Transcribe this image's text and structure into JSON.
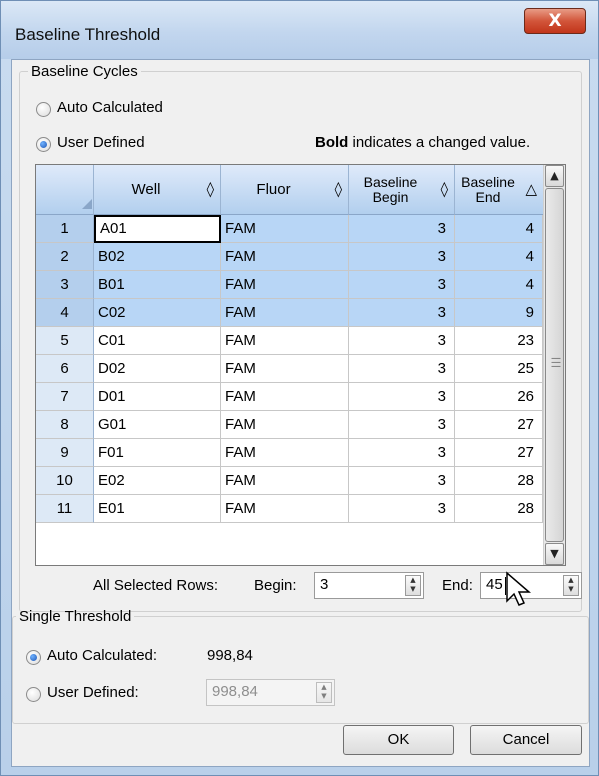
{
  "window": {
    "title": "Baseline Threshold",
    "close_glyph": "X"
  },
  "baseline_cycles": {
    "legend": "Baseline Cycles",
    "auto_label": "Auto Calculated",
    "user_label": "User Defined",
    "selected": "User Defined",
    "note_bold": "Bold",
    "note_rest": " indicates a changed value."
  },
  "grid": {
    "columns": [
      {
        "label": "Well",
        "sort": "◊"
      },
      {
        "label": "Fluor",
        "sort": "◊"
      },
      {
        "label": "Baseline Begin",
        "sort": "◊"
      },
      {
        "label": "Baseline End",
        "sort": "△"
      }
    ],
    "rows": [
      {
        "n": "1",
        "well": "A01",
        "fluor": "FAM",
        "begin": "3",
        "end": "4",
        "selected": true
      },
      {
        "n": "2",
        "well": "B02",
        "fluor": "FAM",
        "begin": "3",
        "end": "4",
        "selected": true
      },
      {
        "n": "3",
        "well": "B01",
        "fluor": "FAM",
        "begin": "3",
        "end": "4",
        "selected": true
      },
      {
        "n": "4",
        "well": "C02",
        "fluor": "FAM",
        "begin": "3",
        "end": "9",
        "selected": true
      },
      {
        "n": "5",
        "well": "C01",
        "fluor": "FAM",
        "begin": "3",
        "end": "23",
        "selected": false
      },
      {
        "n": "6",
        "well": "D02",
        "fluor": "FAM",
        "begin": "3",
        "end": "25",
        "selected": false
      },
      {
        "n": "7",
        "well": "D01",
        "fluor": "FAM",
        "begin": "3",
        "end": "26",
        "selected": false
      },
      {
        "n": "8",
        "well": "G01",
        "fluor": "FAM",
        "begin": "3",
        "end": "27",
        "selected": false
      },
      {
        "n": "9",
        "well": "F01",
        "fluor": "FAM",
        "begin": "3",
        "end": "27",
        "selected": false
      },
      {
        "n": "10",
        "well": "E02",
        "fluor": "FAM",
        "begin": "3",
        "end": "28",
        "selected": false
      },
      {
        "n": "11",
        "well": "E01",
        "fluor": "FAM",
        "begin": "3",
        "end": "28",
        "selected": false
      }
    ]
  },
  "all_selected": {
    "label": "All Selected Rows:",
    "begin_label": "Begin:",
    "begin_value": "3",
    "end_label": "End:",
    "end_value": "45"
  },
  "single_threshold": {
    "legend": "Single Threshold",
    "auto_label": "Auto Calculated:",
    "auto_value": "998,84",
    "user_label": "User Defined:",
    "user_value": "998,84",
    "selected": "Auto Calculated"
  },
  "buttons": {
    "ok": "OK",
    "cancel": "Cancel"
  },
  "colors": {
    "selected_row": "#b8d6f6",
    "header": "#c9dcf0",
    "close_button": "#c1351a"
  },
  "icons": [
    "close-icon",
    "sort-icon",
    "scroll-up-icon",
    "scroll-down-icon",
    "spin-up-icon",
    "spin-down-icon",
    "mouse-cursor-icon"
  ]
}
